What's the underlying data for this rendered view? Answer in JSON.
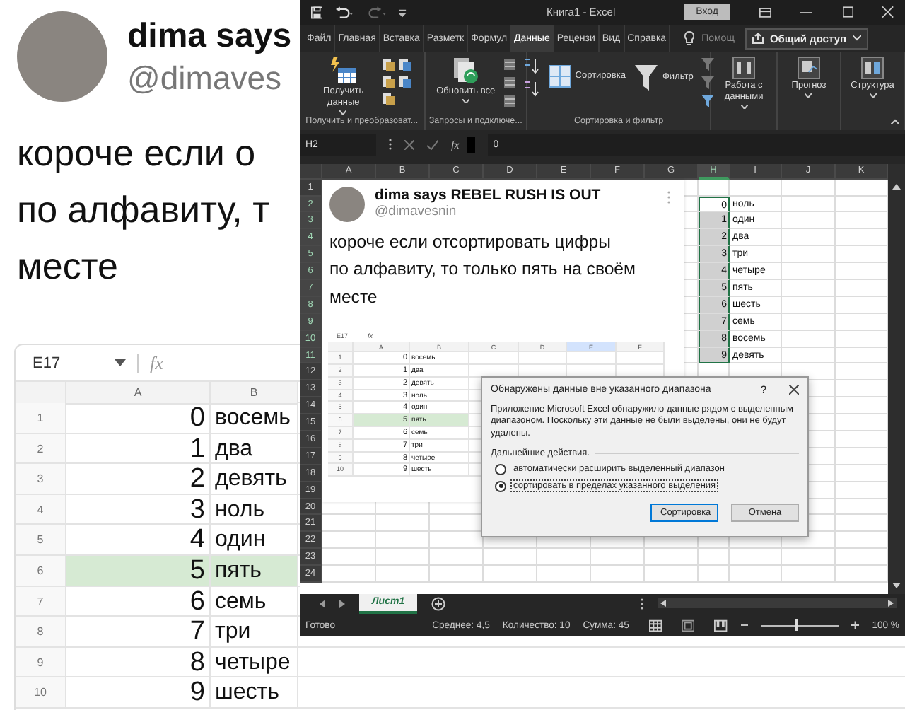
{
  "tweet": {
    "name": "dima says",
    "handle": "@dimaves",
    "text_lines": [
      "короче если о",
      "по алфавиту, т",
      "месте"
    ]
  },
  "sheet": {
    "name_box": "E17",
    "function_label": "fx",
    "columns": [
      {
        "label": "A",
        "selected": false
      },
      {
        "label": "B",
        "selected": false
      }
    ],
    "rows": [
      {
        "row": "1",
        "number": "0",
        "word": "восемь",
        "selected": false
      },
      {
        "row": "2",
        "number": "1",
        "word": "два",
        "selected": false
      },
      {
        "row": "3",
        "number": "2",
        "word": "девять",
        "selected": false
      },
      {
        "row": "4",
        "number": "3",
        "word": "ноль",
        "selected": false
      },
      {
        "row": "5",
        "number": "4",
        "word": "один",
        "selected": false
      },
      {
        "row": "6",
        "number": "5",
        "word": "пять",
        "selected": true
      },
      {
        "row": "7",
        "number": "6",
        "word": "семь",
        "selected": false
      },
      {
        "row": "8",
        "number": "7",
        "word": "три",
        "selected": false
      },
      {
        "row": "9",
        "number": "8",
        "word": "четыре",
        "selected": false
      },
      {
        "row": "10",
        "number": "9",
        "word": "шесть",
        "selected": false
      }
    ]
  },
  "excel": {
    "title": "Книга1  -  Excel",
    "sign_in": "Вход",
    "tabs": [
      {
        "label": "Файл",
        "selected": false
      },
      {
        "label": "Главная",
        "selected": false
      },
      {
        "label": "Вставка",
        "selected": false
      },
      {
        "label": "Разметк",
        "selected": false
      },
      {
        "label": "Формул",
        "selected": false
      },
      {
        "label": "Данные",
        "selected": true
      },
      {
        "label": "Рецензи",
        "selected": false
      },
      {
        "label": "Вид",
        "selected": false
      },
      {
        "label": "Справка",
        "selected": false
      }
    ],
    "help": "Помощ",
    "share": "Общий доступ",
    "ribbon": [
      {
        "label": "Получить и преобразоват...",
        "kind": "get",
        "buttons": [
          {
            "label": "Получить данные",
            "kind": "get-data",
            "dropdown": true
          }
        ]
      },
      {
        "label": "Запросы и подключе...",
        "kind": "queries",
        "buttons": [
          {
            "label": "Обновить все",
            "kind": "refresh",
            "dropdown": true
          }
        ]
      },
      {
        "label": "Сортировка и фильтр",
        "kind": "sort",
        "buttons": [
          {
            "label": "Сортировка",
            "kind": "sort",
            "dropdown": false
          },
          {
            "label": "Фильтр",
            "kind": "filter",
            "dropdown": false
          }
        ]
      },
      {
        "kind": "plain",
        "buttons": [
          {
            "label": "Работа с данными",
            "kind": "data-tools",
            "dropdown": true
          }
        ]
      },
      {
        "kind": "plain",
        "buttons": [
          {
            "label": "Прогноз",
            "kind": "forecast",
            "dropdown": true
          }
        ]
      },
      {
        "kind": "plain",
        "buttons": [
          {
            "label": "Структура",
            "kind": "outline",
            "dropdown": true
          }
        ]
      }
    ],
    "formula_bar": {
      "name_box": "H2",
      "function_label": "fx",
      "value": "0"
    },
    "columns": [
      {
        "label": "A",
        "selected": false
      },
      {
        "label": "B",
        "selected": false
      },
      {
        "label": "C",
        "selected": false
      },
      {
        "label": "D",
        "selected": false
      },
      {
        "label": "E",
        "selected": false
      },
      {
        "label": "F",
        "selected": false
      },
      {
        "label": "G",
        "selected": false
      },
      {
        "label": "H",
        "selected": true
      },
      {
        "label": "I",
        "selected": false
      },
      {
        "label": "J",
        "selected": false
      },
      {
        "label": "K",
        "selected": false
      }
    ],
    "row_headers": [
      {
        "label": "1",
        "selected": false
      },
      {
        "label": "2",
        "selected": true
      },
      {
        "label": "3",
        "selected": true
      },
      {
        "label": "4",
        "selected": true
      },
      {
        "label": "5",
        "selected": true
      },
      {
        "label": "6",
        "selected": true
      },
      {
        "label": "7",
        "selected": true
      },
      {
        "label": "8",
        "selected": true
      },
      {
        "label": "9",
        "selected": true
      },
      {
        "label": "10",
        "selected": true
      },
      {
        "label": "11",
        "selected": true
      },
      {
        "label": "12",
        "selected": false
      },
      {
        "label": "13",
        "selected": false
      },
      {
        "label": "14",
        "selected": false
      },
      {
        "label": "15",
        "selected": false
      },
      {
        "label": "16",
        "selected": false
      },
      {
        "label": "17",
        "selected": false
      },
      {
        "label": "18",
        "selected": false
      },
      {
        "label": "19",
        "selected": false
      },
      {
        "label": "20",
        "selected": false
      },
      {
        "label": "21",
        "selected": false
      },
      {
        "label": "22",
        "selected": false
      },
      {
        "label": "23",
        "selected": false
      },
      {
        "label": "24",
        "selected": false
      }
    ],
    "data_rows": [
      {
        "number": "0",
        "word": "ноль",
        "active": true
      },
      {
        "number": "1",
        "word": "один",
        "active": false
      },
      {
        "number": "2",
        "word": "два",
        "active": false
      },
      {
        "number": "3",
        "word": "три",
        "active": false
      },
      {
        "number": "4",
        "word": "четыре",
        "active": false
      },
      {
        "number": "5",
        "word": "пять",
        "active": false
      },
      {
        "number": "6",
        "word": "шесть",
        "active": false
      },
      {
        "number": "7",
        "word": "семь",
        "active": false
      },
      {
        "number": "8",
        "word": "восемь",
        "active": false
      },
      {
        "number": "9",
        "word": "девять",
        "active": false
      }
    ],
    "picture": {
      "name": "dima says REBEL RUSH IS OUT",
      "handle": "@dimavesnin",
      "text_lines": [
        "короче если отсортировать цифры",
        "по алфавиту, то только пять на своём",
        "месте"
      ],
      "sheet": {
        "name_box": "E17",
        "function_label": "fx",
        "columns": [
          {
            "label": "A",
            "selected": false
          },
          {
            "label": "B",
            "selected": false
          },
          {
            "label": "C",
            "selected": false
          },
          {
            "label": "D",
            "selected": false
          },
          {
            "label": "E",
            "selected": true
          },
          {
            "label": "F",
            "selected": false
          }
        ],
        "rows": [
          {
            "row": "1",
            "number": "0",
            "word": "восемь",
            "selected": false
          },
          {
            "row": "2",
            "number": "1",
            "word": "два",
            "selected": false
          },
          {
            "row": "3",
            "number": "2",
            "word": "девять",
            "selected": false
          },
          {
            "row": "4",
            "number": "3",
            "word": "ноль",
            "selected": false
          },
          {
            "row": "5",
            "number": "4",
            "word": "один",
            "selected": false
          },
          {
            "row": "6",
            "number": "5",
            "word": "пять",
            "selected": true
          },
          {
            "row": "7",
            "number": "6",
            "word": "семь",
            "selected": false
          },
          {
            "row": "8",
            "number": "7",
            "word": "три",
            "selected": false
          },
          {
            "row": "9",
            "number": "8",
            "word": "четыре",
            "selected": false
          },
          {
            "row": "10",
            "number": "9",
            "word": "шесть",
            "selected": false
          }
        ]
      }
    },
    "dialog": {
      "title": "Обнаружены данные вне указанного диапазона",
      "help": "?",
      "message": "Приложение Microsoft Excel обнаружило данные рядом с выделенным диапазоном. Поскольку эти данные не были выделены, они не будут удалены.",
      "prompt": "Дальнейшие действия.",
      "options": [
        {
          "label": "автоматически расширить выделенный диапазон",
          "selected": false
        },
        {
          "label": "сортировать в пределах указанного выделения",
          "selected": true
        }
      ],
      "buttons": [
        {
          "label": "Сортировка",
          "kind": "default"
        },
        {
          "label": "Отмена",
          "kind": "normal"
        }
      ]
    },
    "sheet_tabs": [
      {
        "label": "Лист1",
        "selected": true
      }
    ],
    "status_bar": {
      "state": "Готово",
      "average": "Среднее: 4,5",
      "count": "Количество: 10",
      "sum": "Сумма: 45",
      "zoom": {
        "level": 0.45,
        "reading": "100 %"
      }
    }
  }
}
